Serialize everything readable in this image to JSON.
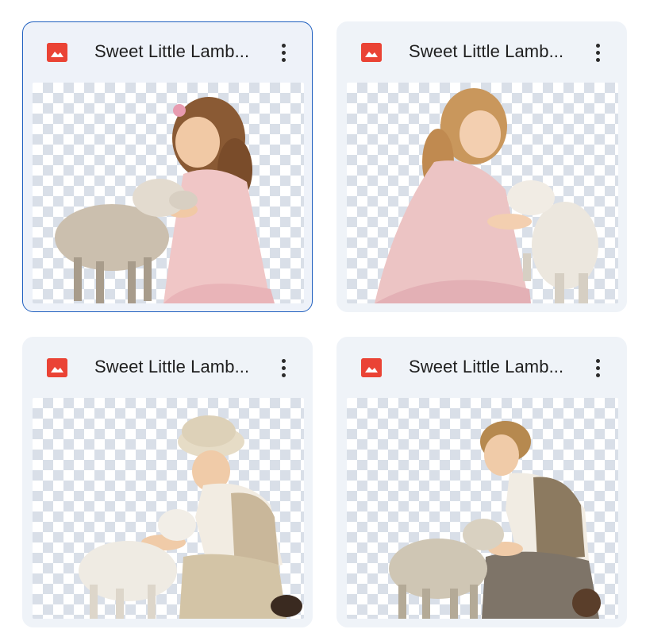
{
  "files": [
    {
      "title": "Sweet Little Lamb...",
      "selected": true,
      "icon": "image-file-icon",
      "scene": "girl-with-lamb-hug"
    },
    {
      "title": "Sweet Little Lamb...",
      "selected": false,
      "icon": "image-file-icon",
      "scene": "girl-with-lamb-kneel"
    },
    {
      "title": "Sweet Little Lamb...",
      "selected": false,
      "icon": "image-file-icon",
      "scene": "boy-cap-with-lamb"
    },
    {
      "title": "Sweet Little Lamb...",
      "selected": false,
      "icon": "image-file-icon",
      "scene": "boy-vest-with-lamb"
    }
  ],
  "colors": {
    "icon_red": "#ea4335",
    "selected_border": "#1f5fbf",
    "card_bg": "#eff3f8"
  }
}
